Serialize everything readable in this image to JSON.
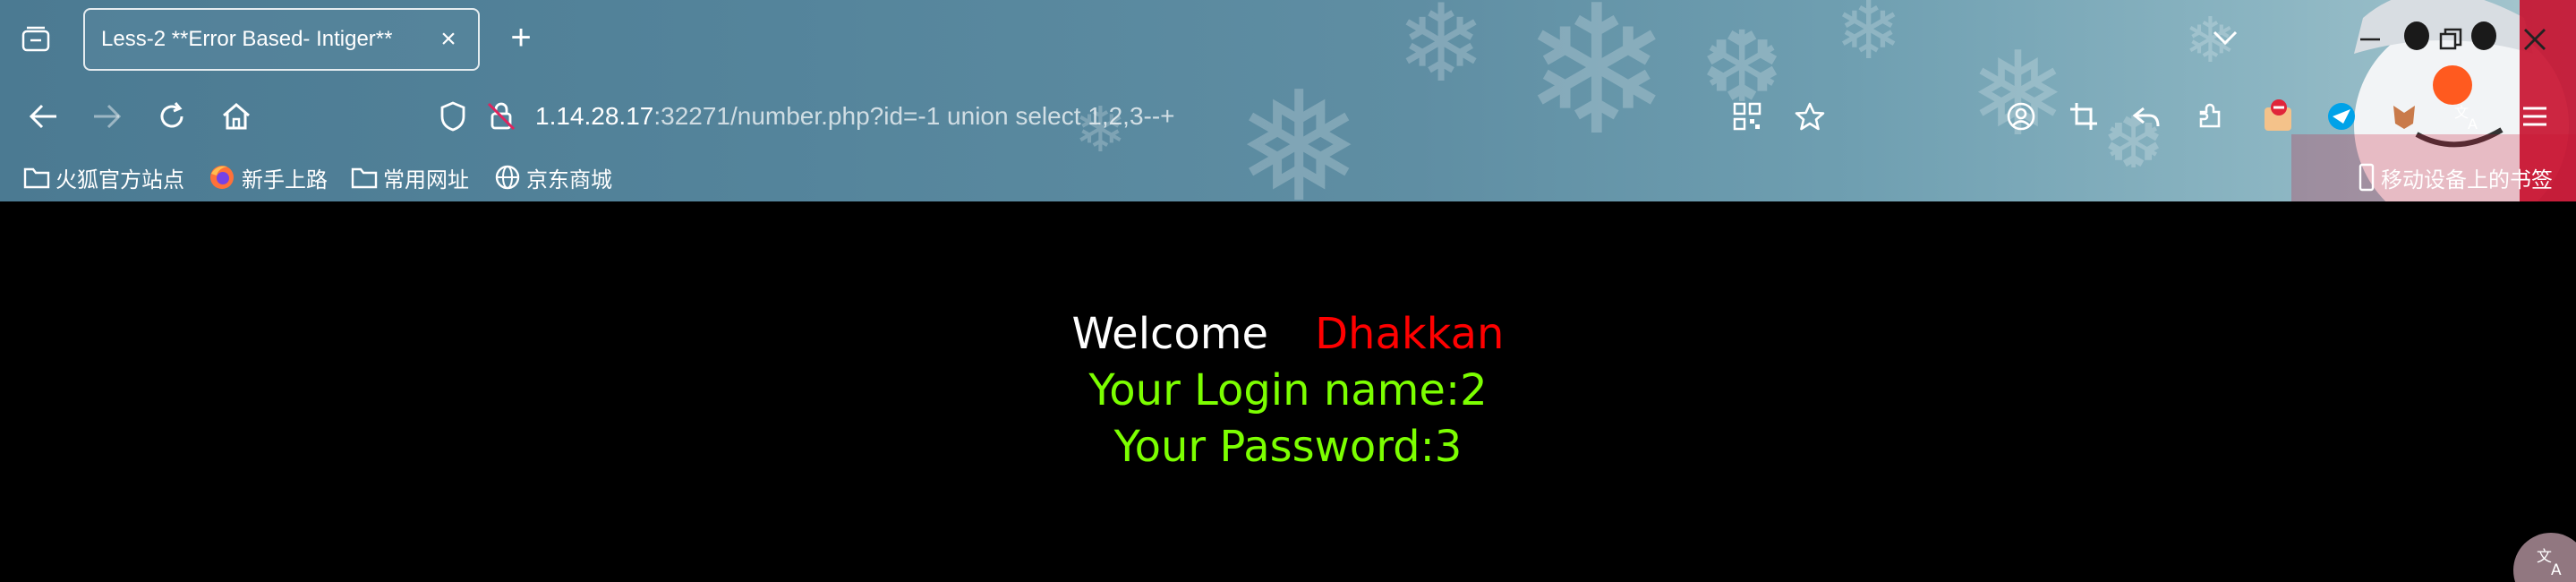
{
  "tab": {
    "title": "Less-2 **Error Based- Intiger**",
    "close_glyph": "×",
    "new_tab_glyph": "+"
  },
  "address_bar": {
    "url_host": "1.14.28.17",
    "url_rest": ":32271/number.php?id=-1 union select 1,2,3--+"
  },
  "bookmarks": {
    "items": [
      {
        "label": "火狐官方站点",
        "icon": "folder-icon"
      },
      {
        "label": "新手上路",
        "icon": "firefox-icon"
      },
      {
        "label": "常用网址",
        "icon": "folder-icon"
      },
      {
        "label": "京东商城",
        "icon": "globe-icon"
      }
    ],
    "mobile": {
      "label": "移动设备上的书签",
      "icon": "mobile-icon"
    }
  },
  "page": {
    "welcome_word": "Welcome",
    "welcome_name": "Dhakkan",
    "login_line": "Your Login name:2",
    "password_line": "Your Password:3"
  },
  "colors": {
    "page_background": "#000000",
    "welcome_text": "#ffffff",
    "name_text": "#ff0000",
    "result_text": "#7cff00",
    "chrome_accent": "#4b7a92"
  },
  "icons": {
    "toolbar_right": [
      "account-icon",
      "screenshot-crop-icon",
      "undo-icon",
      "extensions-icon",
      "adblock-icon",
      "extension-bird-icon",
      "extension-fox-icon",
      "translate-icon",
      "menu-icon"
    ]
  }
}
